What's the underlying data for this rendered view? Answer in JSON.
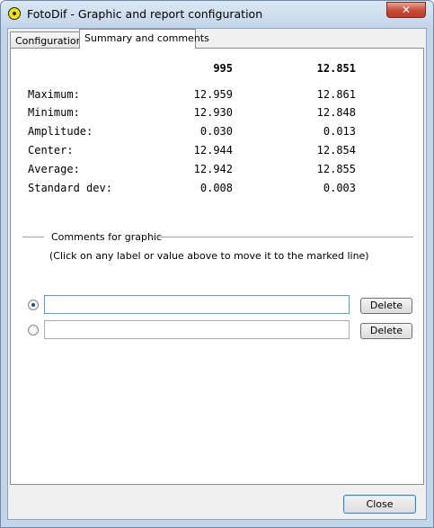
{
  "window": {
    "title": "FotoDif - Graphic and report configuration",
    "close_glyph": "✕"
  },
  "tabs": [
    {
      "label": "Configuration",
      "active": false
    },
    {
      "label": "Summary and comments",
      "active": true
    }
  ],
  "summary": {
    "headers": [
      "995",
      "12.851"
    ],
    "rows": [
      {
        "label": "Maximum:",
        "v1": "12.959",
        "v2": "12.861"
      },
      {
        "label": "Minimum:",
        "v1": "12.930",
        "v2": "12.848"
      },
      {
        "label": "Amplitude:",
        "v1": "0.030",
        "v2": "0.013"
      },
      {
        "label": "Center:",
        "v1": "12.944",
        "v2": "12.854"
      },
      {
        "label": "Average:",
        "v1": "12.942",
        "v2": "12.855"
      },
      {
        "label": "Standard dev:",
        "v1": "0.008",
        "v2": "0.003"
      }
    ]
  },
  "comments": {
    "section_title": "Comments for graphic",
    "hint": "(Click on any label or value above to move it to the marked line)",
    "lines": [
      {
        "value": "",
        "selected": true,
        "delete_label": "Delete"
      },
      {
        "value": "",
        "selected": false,
        "delete_label": "Delete"
      }
    ]
  },
  "footer": {
    "close_label": "Close"
  },
  "colors": {
    "accent": "#569de5",
    "close_button": "#c74b34",
    "frame": "#c3d5e9"
  },
  "icons": {
    "app": "fotodif-app-icon",
    "close": "close-icon"
  }
}
